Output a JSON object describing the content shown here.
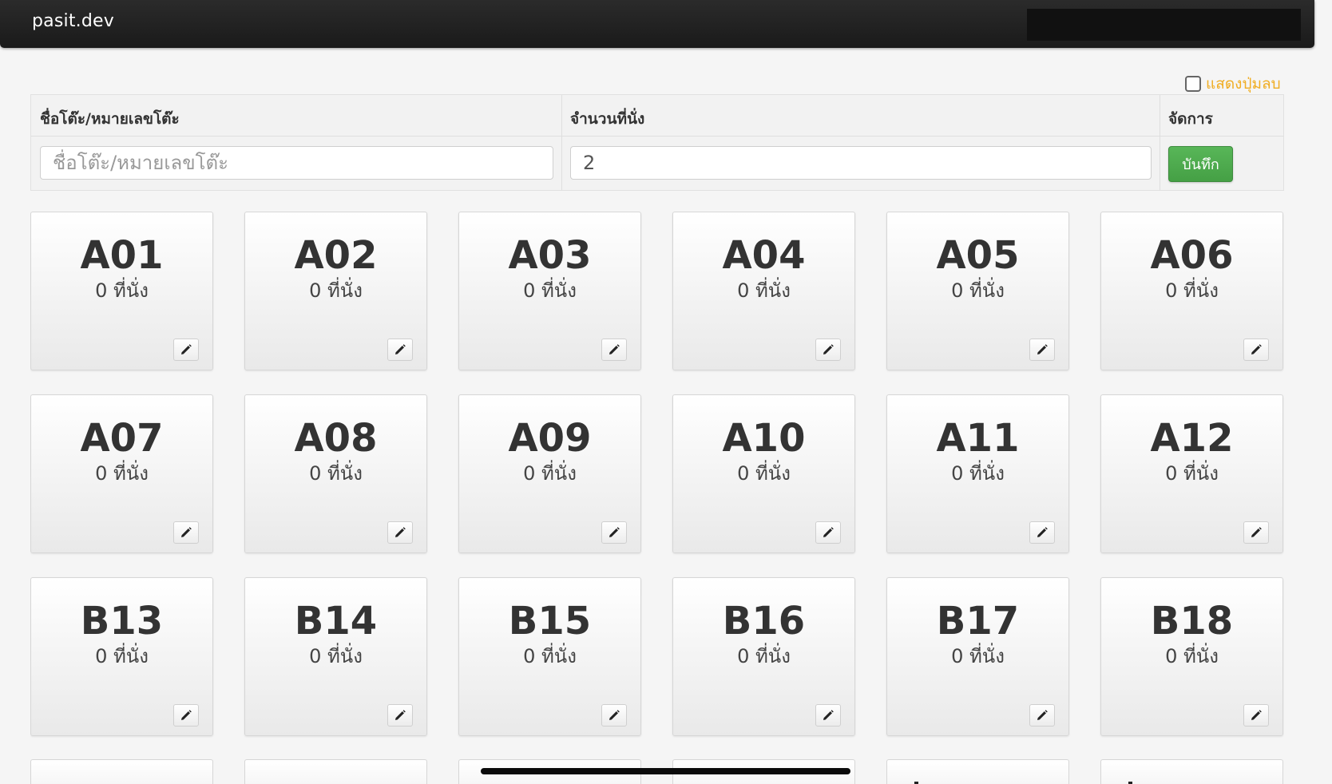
{
  "app": {
    "brand": "pasit.dev"
  },
  "toggle": {
    "label": "แสดงปุ่มลบ",
    "checked": false
  },
  "form": {
    "headers": [
      "ชื่อโต๊ะ/หมายเลขโต๊ะ",
      "จำนวนที่นั่ง",
      "จัดการ"
    ],
    "table_name_placeholder": "ชื่อโต๊ะ/หมายเลขโต๊ะ",
    "seat_count_value": "2",
    "save_label": "บันทึก"
  },
  "tables": [
    {
      "name": "A01",
      "seats": "0 ที่นั่ง"
    },
    {
      "name": "A02",
      "seats": "0 ที่นั่ง"
    },
    {
      "name": "A03",
      "seats": "0 ที่นั่ง"
    },
    {
      "name": "A04",
      "seats": "0 ที่นั่ง"
    },
    {
      "name": "A05",
      "seats": "0 ที่นั่ง"
    },
    {
      "name": "A06",
      "seats": "0 ที่นั่ง"
    },
    {
      "name": "A07",
      "seats": "0 ที่นั่ง"
    },
    {
      "name": "A08",
      "seats": "0 ที่นั่ง"
    },
    {
      "name": "A09",
      "seats": "0 ที่นั่ง"
    },
    {
      "name": "A10",
      "seats": "0 ที่นั่ง"
    },
    {
      "name": "A11",
      "seats": "0 ที่นั่ง"
    },
    {
      "name": "A12",
      "seats": "0 ที่นั่ง"
    },
    {
      "name": "B13",
      "seats": "0 ที่นั่ง"
    },
    {
      "name": "B14",
      "seats": "0 ที่นั่ง"
    },
    {
      "name": "B15",
      "seats": "0 ที่นั่ง"
    },
    {
      "name": "B16",
      "seats": "0 ที่นั่ง"
    },
    {
      "name": "B17",
      "seats": "0 ที่นั่ง"
    },
    {
      "name": "B18",
      "seats": "0 ที่นั่ง"
    }
  ],
  "icons": {
    "edit": "pencil-icon",
    "toggle": "checkbox-icon"
  },
  "colors": {
    "navbar": "#1f1f1f",
    "accent_toggle": "#f0ad22",
    "save_button": "#4cae4c",
    "card_border": "#d6d6d6"
  }
}
